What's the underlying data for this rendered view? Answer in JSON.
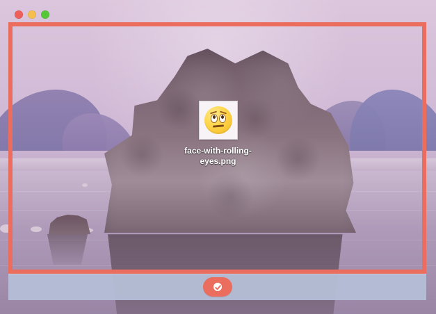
{
  "window": {
    "controls": [
      {
        "name": "close",
        "color": "#ef5f5a"
      },
      {
        "name": "minimize",
        "color": "#f5bf4f"
      },
      {
        "name": "zoom",
        "color": "#57c73a"
      }
    ]
  },
  "drop_zone": {
    "accent_color": "#ea6d5e"
  },
  "file": {
    "name": "face-with-rolling-eyes.png",
    "icon": "face-with-rolling-eyes-icon"
  },
  "footer": {
    "action_icon": "check-circle-icon",
    "bar_color": "#b4bfd6"
  },
  "background": {
    "image": "mono-lake-rock-landscape"
  }
}
